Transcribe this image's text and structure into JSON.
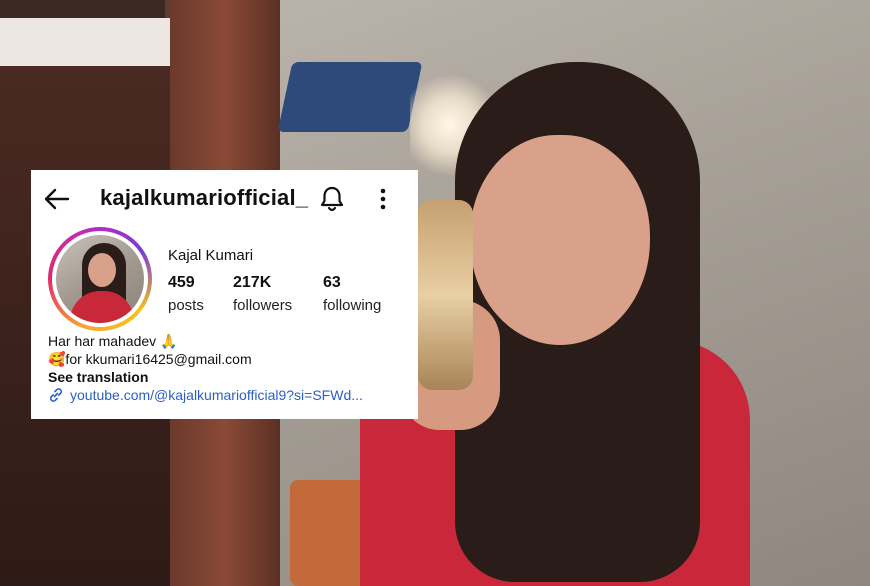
{
  "profile": {
    "username": "kajalkumariofficial_",
    "display_name": "Kajal Kumari",
    "stats": [
      {
        "value": "459",
        "label": "posts"
      },
      {
        "value": "217K",
        "label": "followers"
      },
      {
        "value": "63",
        "label": "following"
      }
    ],
    "bio": {
      "line1": "Har har mahadev 🙏",
      "line2": "🥰for  kkumari16425@gmail.com",
      "see_translation": "See translation"
    },
    "link": "youtube.com/@kajalkumariofficial9?si=SFWd..."
  },
  "icons": {
    "back": "arrow-left-icon",
    "notifications": "bell-icon",
    "more": "vertical-dots-icon",
    "link": "link-icon"
  },
  "colors": {
    "link": "#2a5ec9",
    "story_ring_start": "#f9a23a",
    "story_ring_mid": "#e12a6a",
    "story_ring_end": "#7a3bd8"
  }
}
